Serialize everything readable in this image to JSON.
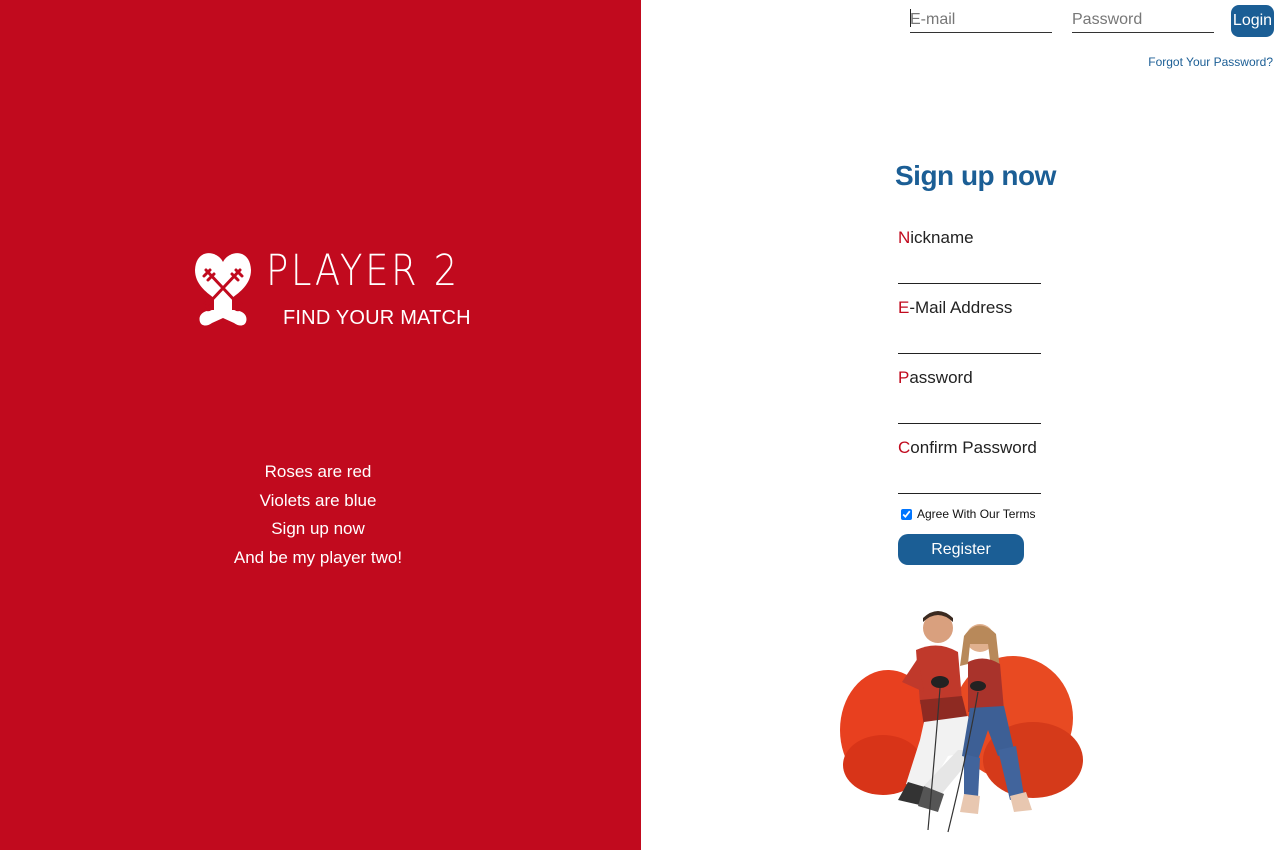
{
  "brand": {
    "title": "PLAYER 2",
    "subtitle": "FIND YOUR MATCH"
  },
  "poem": [
    "Roses are red",
    "Violets are blue",
    "Sign up now",
    "And be my player two!"
  ],
  "header_login": {
    "email_placeholder": "E-mail",
    "password_placeholder": "Password",
    "login_label": "Login",
    "forgot_password": "Forgot Your Password?"
  },
  "signup": {
    "title": "Sign up now",
    "fields": [
      {
        "first": "N",
        "rest": "ickname"
      },
      {
        "first": "E",
        "rest": "-Mail Address"
      },
      {
        "first": "P",
        "rest": "assword"
      },
      {
        "first": "C",
        "rest": "onfirm Password"
      }
    ],
    "terms_label": "Agree With Our Terms",
    "terms_checked": true,
    "register_label": "Register"
  },
  "colors": {
    "brand_red": "#c10a1e",
    "accent_blue": "#1b5e95"
  },
  "icons": {
    "logo": "heart-with-crossed-keys-icon"
  }
}
